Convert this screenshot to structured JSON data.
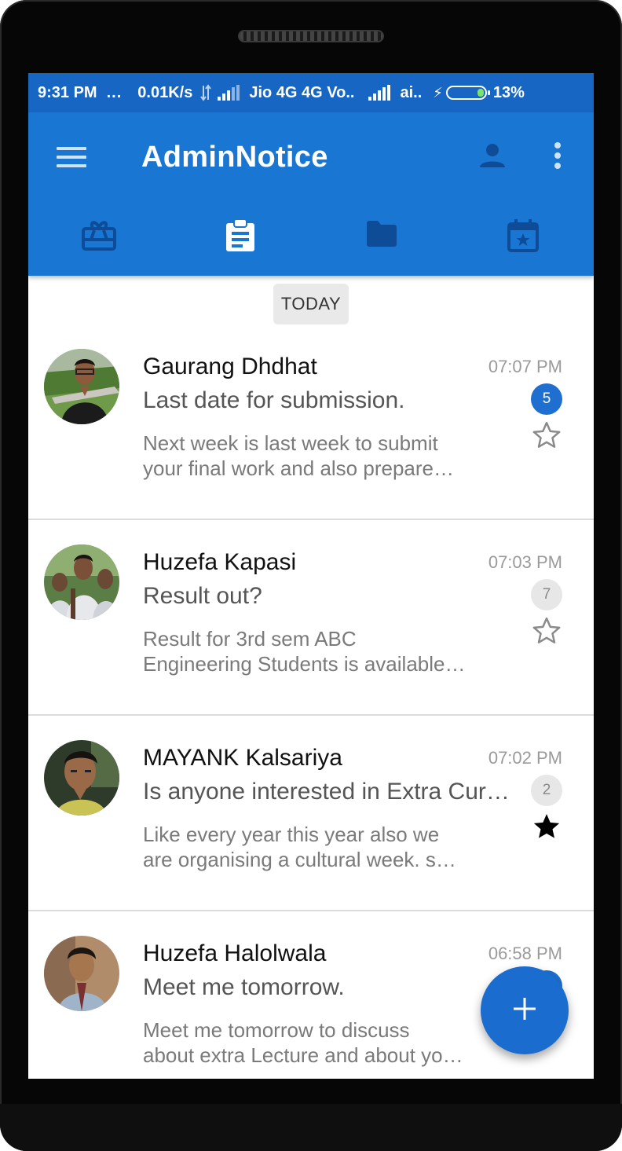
{
  "status_bar": {
    "time": "9:31 PM",
    "dots": "...",
    "net_speed": "0.01K/s",
    "carrier1": "Jio 4G 4G Vo..",
    "carrier2": "ai..",
    "battery": "13%"
  },
  "app_bar": {
    "title": "AdminNotice",
    "tabs": [
      {
        "icon": "gift-card-icon",
        "selected": false
      },
      {
        "icon": "clipboard-icon",
        "selected": true
      },
      {
        "icon": "folder-icon",
        "selected": false
      },
      {
        "icon": "calendar-star-icon",
        "selected": false
      }
    ]
  },
  "date_header": "TODAY",
  "notices": [
    {
      "sender": "Gaurang Dhdhat",
      "time": "07:07 PM",
      "subject": "Last date for submission.",
      "preview_line1": "Next week is last week to submit",
      "preview_line2": "your final work and also prepare…",
      "badge": "5",
      "badge_active": true,
      "starred": false,
      "avatar": "avatar-gaurang"
    },
    {
      "sender": "Huzefa Kapasi",
      "time": "07:03 PM",
      "subject": "Result out?",
      "preview_line1": "Result for 3rd sem ABC",
      "preview_line2": "Engineering Students is available…",
      "badge": "7",
      "badge_active": false,
      "starred": false,
      "avatar": "avatar-huzefa-k"
    },
    {
      "sender": "MAYANK Kalsariya",
      "time": "07:02 PM",
      "subject": "Is anyone interested in Extra Cur…",
      "preview_line1": "Like every year this year also we",
      "preview_line2": "are organising a cultural week. s…",
      "badge": "2",
      "badge_active": false,
      "starred": true,
      "avatar": "avatar-mayank"
    },
    {
      "sender": "Huzefa Halolwala",
      "time": "06:58 PM",
      "subject": "Meet me tomorrow.",
      "preview_line1": "Meet me tomorrow to discuss",
      "preview_line2": "about extra Lecture and about yo…",
      "badge": "",
      "badge_active": true,
      "starred": false,
      "avatar": "avatar-huzefa-h"
    }
  ],
  "fab": {
    "icon": "plus-icon"
  },
  "colors": {
    "primary": "#1976d2",
    "status_bar": "#1766c4",
    "tab_icon_inactive": "#0f4c97",
    "badge_active": "#1e6fd0"
  }
}
